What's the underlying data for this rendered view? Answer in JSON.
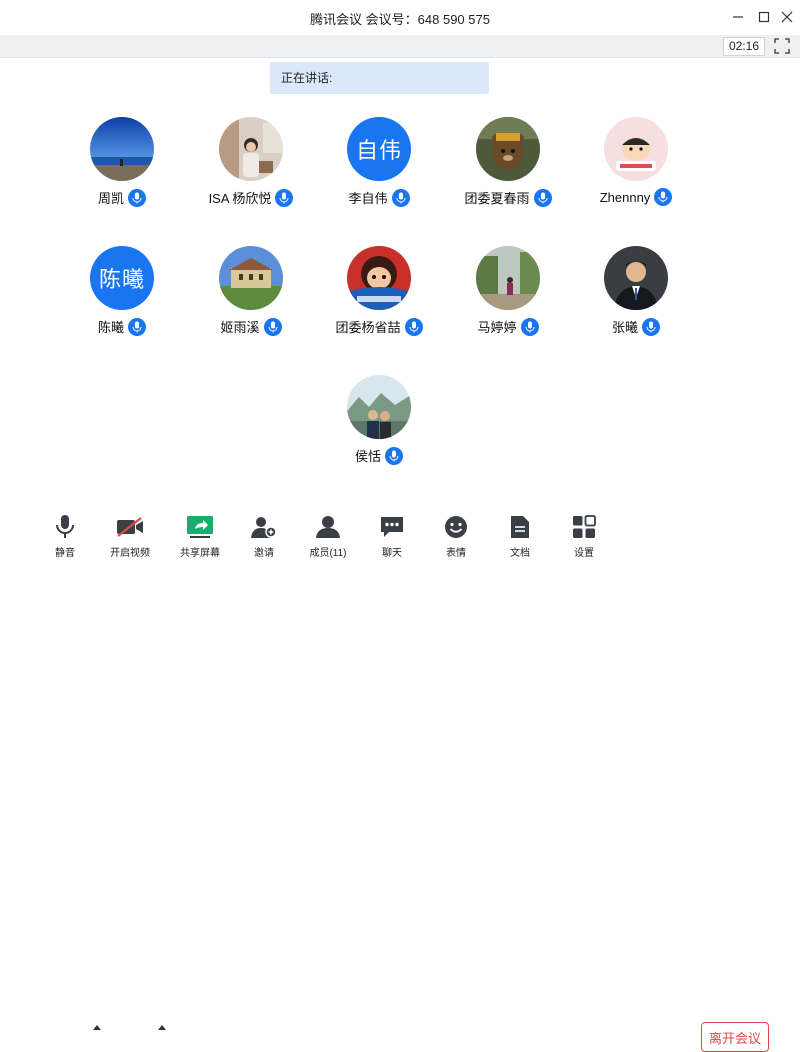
{
  "window": {
    "title": "腾讯会议 会议号：648 590 575"
  },
  "status": {
    "timer": "02:16",
    "speaking_label": "正在讲话:"
  },
  "participants": [
    {
      "name": "周凯",
      "avatar": "photo-sky-sea"
    },
    {
      "name": "ISA 杨欣悦",
      "avatar": "photo-woman-room"
    },
    {
      "name": "李自伟",
      "avatar_text": "自伟"
    },
    {
      "name": "团委夏春雨",
      "avatar": "photo-bear-toy"
    },
    {
      "name": "Zhennny",
      "avatar": "photo-cartoon-boy"
    },
    {
      "name": "陈曦",
      "avatar_text": "陈曦"
    },
    {
      "name": "姬雨溪",
      "avatar": "photo-building-garden"
    },
    {
      "name": "团委杨省喆",
      "avatar": "photo-cartoon-girl"
    },
    {
      "name": "马婷婷",
      "avatar": "photo-garden-person"
    },
    {
      "name": "张曦",
      "avatar": "photo-man-suit"
    },
    {
      "name": "侯恬",
      "avatar": "photo-couple-mountains"
    }
  ],
  "toolbar": {
    "mute": "静音",
    "video": "开启视频",
    "share": "共享屏幕",
    "invite": "邀请",
    "members": "成员(11)",
    "chat": "聊天",
    "reactions": "表情",
    "docs": "文档",
    "settings": "设置",
    "leave": "离开会议"
  },
  "colors": {
    "accent": "#1a75f0",
    "leave": "#e04848",
    "share_green": "#1aad6e"
  }
}
